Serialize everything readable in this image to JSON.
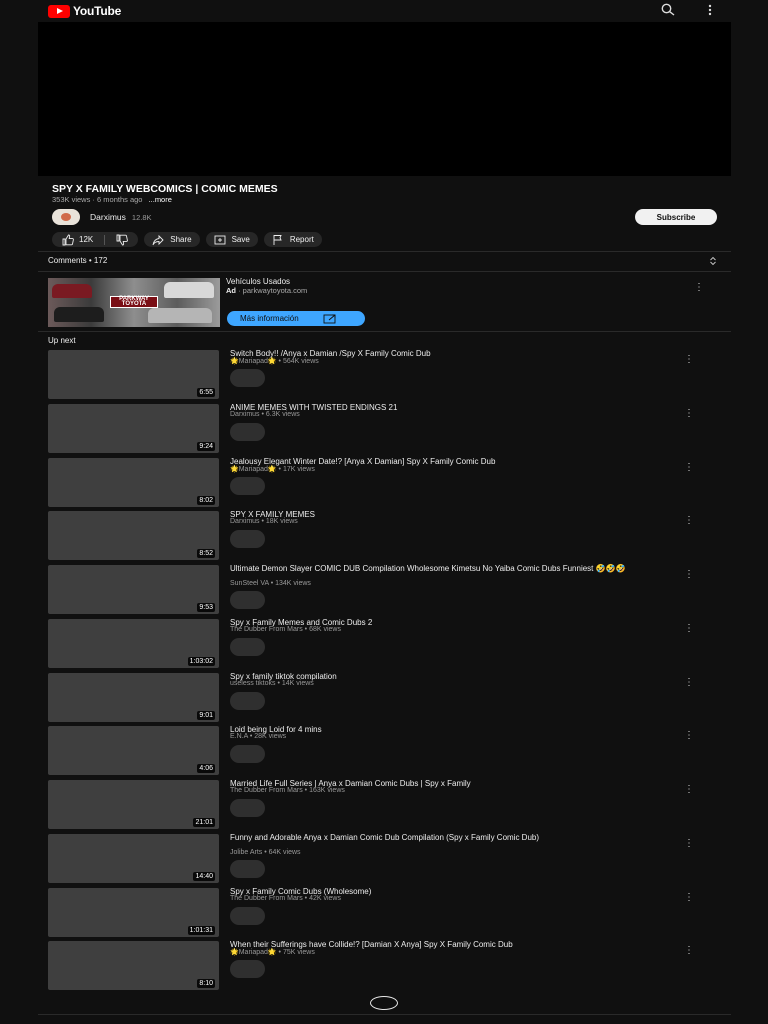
{
  "app": {
    "logo_text": "YouTube"
  },
  "icons": {
    "search": "search-icon",
    "more": "more-vert-icon"
  },
  "video": {
    "title": "SPY X FAMILY WEBCOMICS | COMIC MEMES",
    "meta": "353K views · 6 months ago",
    "more_label": "...more",
    "channel_name": "Darximus",
    "channel_subs": "12.8K",
    "subscribe_label": "Subscribe",
    "likes": "12K",
    "share_label": "Share",
    "save_label": "Save",
    "report_label": "Report"
  },
  "comments": {
    "label": "Comments • 172"
  },
  "ad": {
    "title": "Vehículos Usados",
    "ad_label": "Ad",
    "domain": "· parkwaytoyota.com",
    "cta_label": "Más información",
    "logo_text": "PARKWAY TOYOTA"
  },
  "upnext": {
    "label": "Up next",
    "items": [
      {
        "title": "Switch Body!! /Anya x Damian /Spy X Family Comic Dub",
        "meta": "🌟Mariapad🌟 • 564K views",
        "duration": "6:55"
      },
      {
        "title": "ANIME MEMES WITH TWISTED ENDINGS 21",
        "meta": "Darximus • 6.3K views",
        "duration": "9:24"
      },
      {
        "title": "Jealousy Elegant Winter Date!? [Anya X Damian] Spy X Family Comic Dub",
        "meta": "🌟Mariapad🌟 • 17K views",
        "duration": "8:02"
      },
      {
        "title": "SPY X FAMILY MEMES",
        "meta": "Darximus • 18K views",
        "duration": "8:52"
      },
      {
        "title": "Ultimate Demon Slayer COMIC DUB Compilation Wholesome Kimetsu No Yaiba Comic Dubs Funniest 🤣🤣🤣",
        "meta": "SunSteel VA • 134K views",
        "duration": "9:53"
      },
      {
        "title": "Spy x Family Memes and Comic Dubs 2",
        "meta": "The Dubber From Mars • 68K views",
        "duration": "1:03:02"
      },
      {
        "title": "Spy x family tiktok compilation",
        "meta": "useless tiktoks • 14K views",
        "duration": "9:01"
      },
      {
        "title": "Loid being Loid for 4 mins",
        "meta": "E.N.A • 28K views",
        "duration": "4:06"
      },
      {
        "title": "Married Life Full Series | Anya x Damian Comic Dubs | Spy x Family",
        "meta": "The Dubber From Mars • 163K views",
        "duration": "21:01"
      },
      {
        "title": "Funny and Adorable Anya x Damian Comic Dub Compilation (Spy x Family Comic Dub)",
        "meta": "Jolibe Arts • 64K views",
        "duration": "14:40"
      },
      {
        "title": "Spy x Family Comic Dubs (Wholesome)",
        "meta": "The Dubber From Mars • 42K views",
        "duration": "1:01:31"
      },
      {
        "title": "When their Sufferings have Collide!? [Damian X Anya] Spy X Family Comic Dub",
        "meta": "🌟Mariapad🌟 • 75K views",
        "duration": "8:10"
      }
    ]
  }
}
